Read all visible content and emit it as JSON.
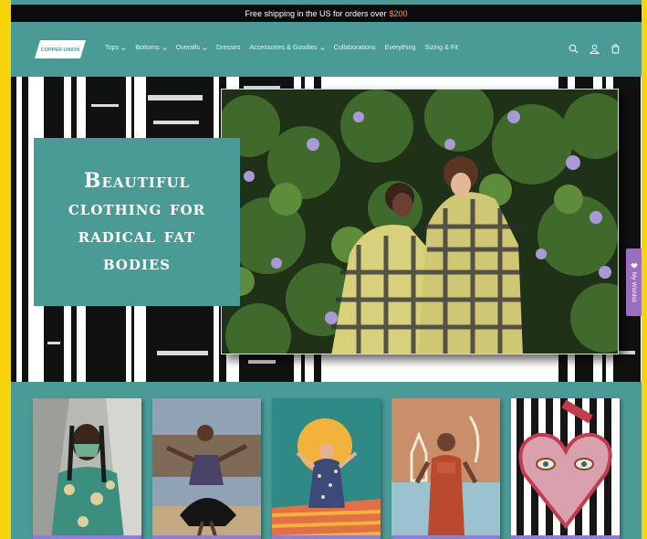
{
  "announcement": {
    "text": "Free shipping in the US for orders over",
    "amount": "$200"
  },
  "brand": {
    "name": "COPPER UNION"
  },
  "nav": [
    {
      "label": "Tops",
      "dropdown": true
    },
    {
      "label": "Bottoms",
      "dropdown": true
    },
    {
      "label": "Overalls",
      "dropdown": true
    },
    {
      "label": "Dresses",
      "dropdown": false
    },
    {
      "label": "Accessories & Goodies",
      "dropdown": true
    },
    {
      "label": "Collaborations",
      "dropdown": false
    },
    {
      "label": "Everything",
      "dropdown": false
    },
    {
      "label": "Sizing & Fit",
      "dropdown": false
    }
  ],
  "header_icons": [
    "search-icon",
    "account-icon",
    "cart-icon"
  ],
  "hero": {
    "headline": "Beautiful clothing for radical fat bodies"
  },
  "wishlist": {
    "label": "My Wishlist"
  },
  "colors": {
    "accent": "#4a9a96",
    "frame": "#f7d40a",
    "announce_bg": "#0b0b0b",
    "highlight": "#f39a6b",
    "card_band": "#8f7fd3"
  }
}
